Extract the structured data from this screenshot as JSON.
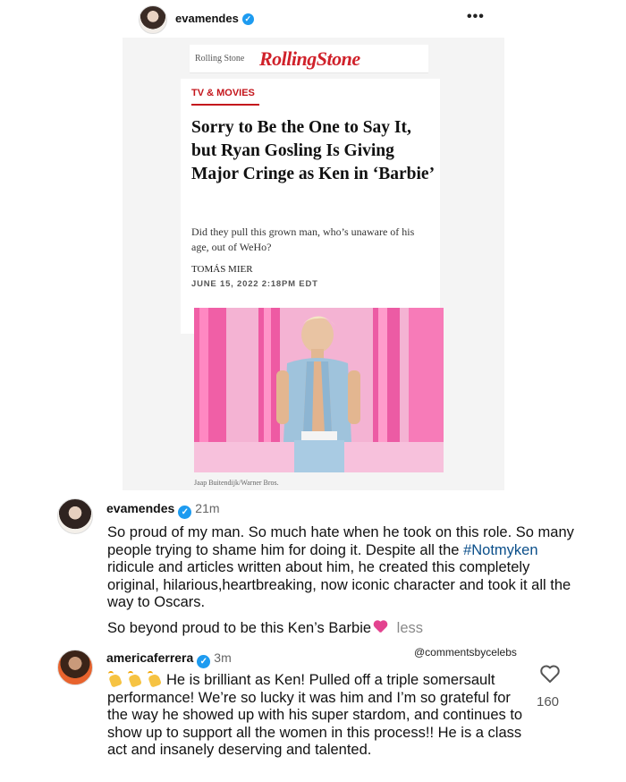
{
  "post": {
    "username": "evamendes",
    "verified_glyph": "✓",
    "more_icon": "•••"
  },
  "article": {
    "masthead_small": "Rolling Stone",
    "masthead_logo": "RollingStone",
    "category": "TV & MOVIES",
    "headline": "Sorry to Be the One to Say It, but Ryan Gosling Is Giving Major Cringe as Ken in ‘Barbie’",
    "dek": "Did they pull this grown man, who’s unaware of his age, out of WeHo?",
    "author": "TOMÁS MIER",
    "date": "JUNE 15, 2022 2:18PM EDT",
    "photo_credit": "Jaap Buitendijk/Warner Bros."
  },
  "comments": [
    {
      "username": "evamendes",
      "time": "21m",
      "text_part1": "So proud of my man. So much hate when he took on this role. So many people trying to shame him for doing it. Despite all the",
      "hashtag": "#Notmyken",
      "text_part2": " ridicule and articles written about him, he created this completely original, hilarious,heartbreaking, now iconic character and took it all the way to Oscars.",
      "text_second_para": "So beyond proud to be this Ken’s Barbie",
      "less_label": "less"
    },
    {
      "username": "americaferrera",
      "time": "3m",
      "text": "He is brilliant as Ken! Pulled off a triple somersault performance! We’re so lucky it was him and I’m so grateful for the way he showed up with his super stardom, and continues to show up to support all the women in this process!! He is a class act and insanely deserving and talented.",
      "like_count": "160"
    }
  ],
  "watermark": "@commentsbycelebs",
  "colors": {
    "verified": "#1d9bf0",
    "rolling_stone_red": "#d0212a",
    "hashtag": "#0b4f8a",
    "photo_pink": "#f2a9cf"
  }
}
